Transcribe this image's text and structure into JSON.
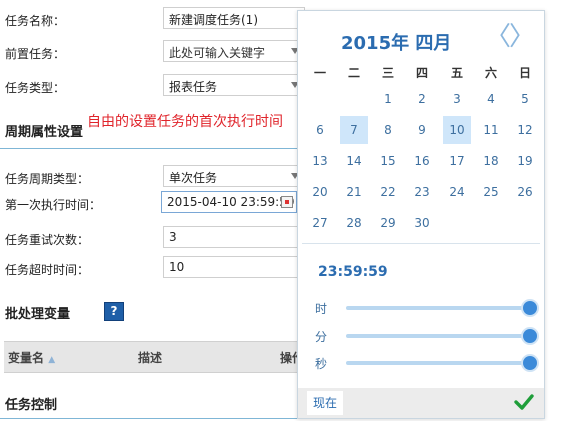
{
  "form": {
    "task_name_label": "任务名称：",
    "task_name_value": "新建调度任务(1)",
    "pre_task_label": "前置任务：",
    "pre_task_value": "此处可输入关键字",
    "task_type_label": "任务类型：",
    "task_type_value": "报表任务",
    "period_section_title": "周期属性设置",
    "annotation": "自由的设置任务的首次执行时间",
    "period_type_label": "任务周期类型：",
    "period_type_value": "单次任务",
    "first_run_label": "第一次执行时间：",
    "first_run_value": "2015-04-10 23:59:59",
    "retry_label": "任务重试次数：",
    "retry_value": "3",
    "timeout_label": "任务超时时间：",
    "timeout_value": "10",
    "batch_section_title": "批处理变量",
    "help_label": "?",
    "table_headers": [
      "变量名",
      "描述",
      "操作"
    ],
    "control_section_title": "任务控制"
  },
  "calendar": {
    "title": "2015年 四月",
    "prev": "〈",
    "next": "〉",
    "weekdays": [
      "一",
      "二",
      "三",
      "四",
      "五",
      "六",
      "日"
    ],
    "weeks": [
      [
        "",
        "",
        "1",
        "2",
        "3",
        "4",
        "5"
      ],
      [
        "6",
        "7",
        "8",
        "9",
        "10",
        "11",
        "12"
      ],
      [
        "13",
        "14",
        "15",
        "16",
        "17",
        "18",
        "19"
      ],
      [
        "20",
        "21",
        "22",
        "23",
        "24",
        "25",
        "26"
      ],
      [
        "27",
        "28",
        "29",
        "30",
        "",
        "",
        ""
      ]
    ],
    "highlighted_days": [
      "7",
      "10"
    ],
    "time": "23:59:59",
    "hour_label": "时",
    "minute_label": "分",
    "second_label": "秒",
    "hour_level": 1.0,
    "minute_level": 1.0,
    "second_level": 1.0,
    "now_label": "现在",
    "confirm_icon": "check-icon"
  }
}
